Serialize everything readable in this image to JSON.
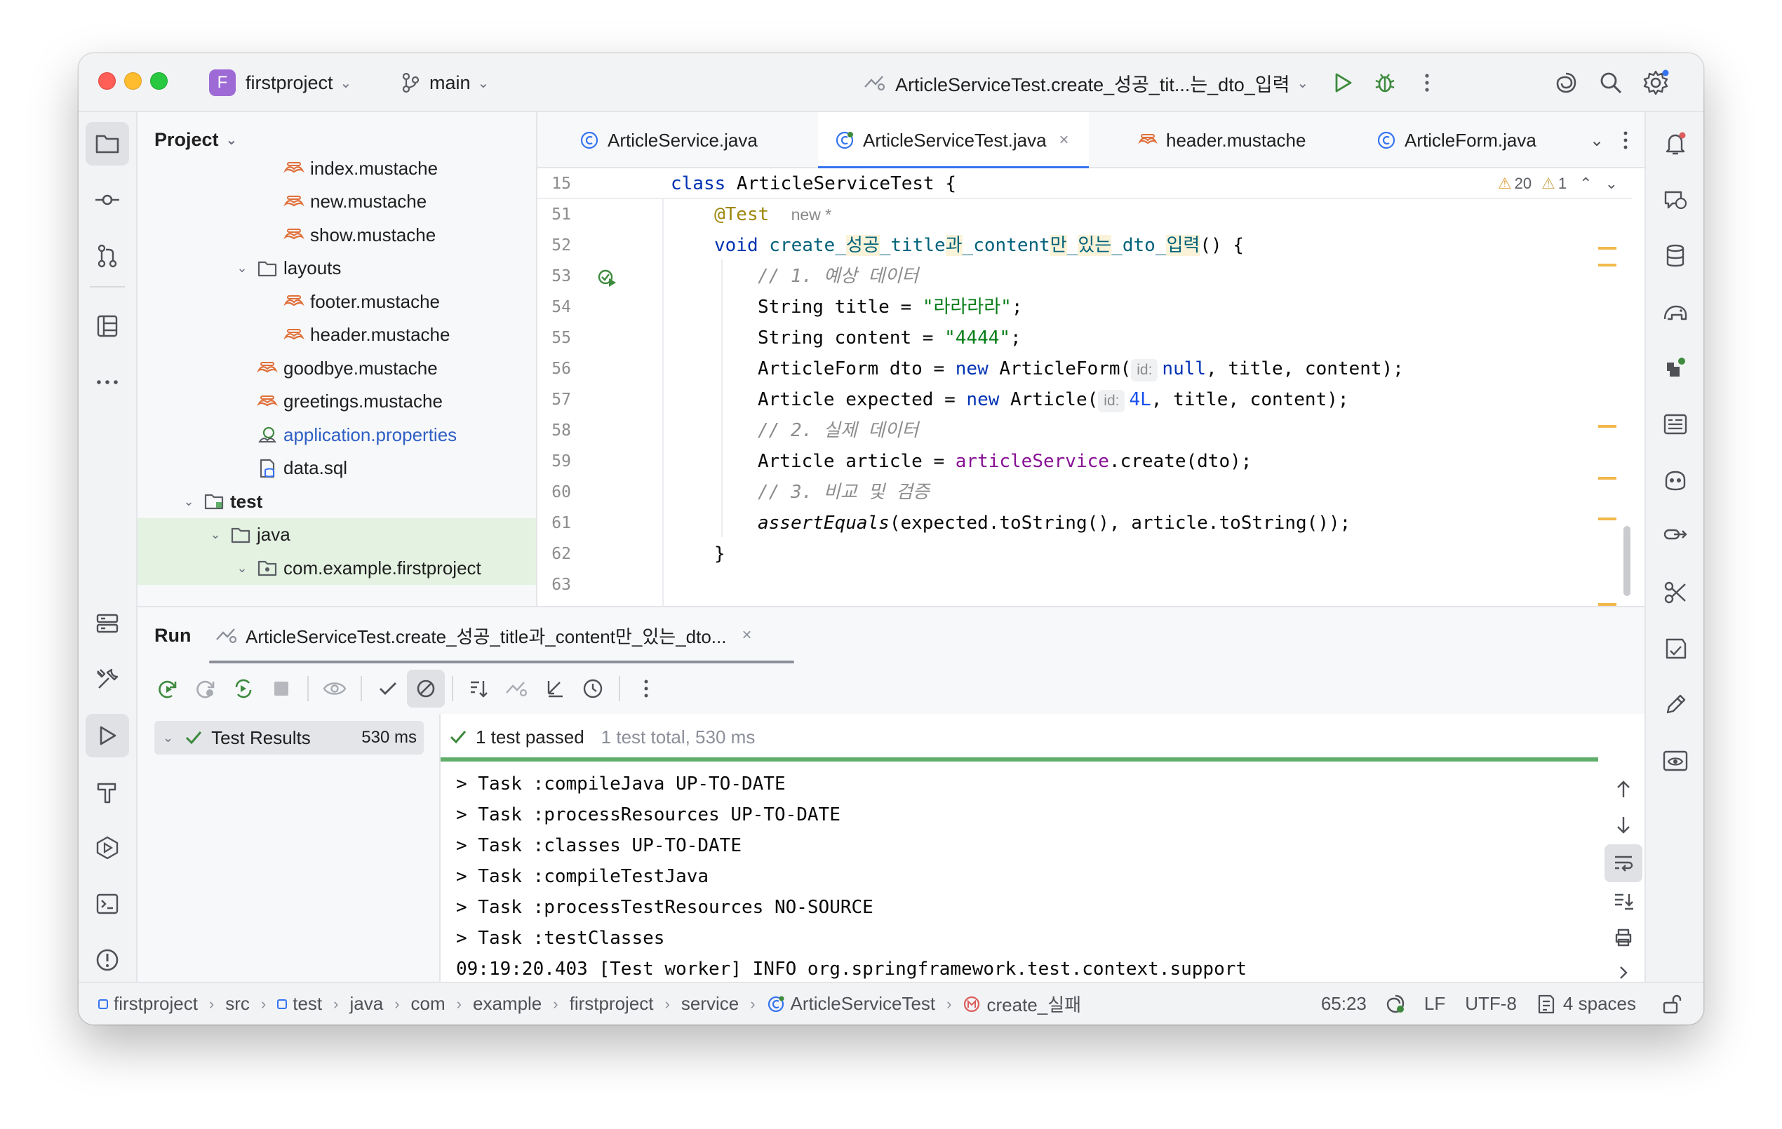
{
  "titlebar": {
    "project_badge": "F",
    "project_name": "firstproject",
    "branch": "main",
    "run_config": "ArticleServiceTest.create_성공_tit...는_dto_입력"
  },
  "project_panel": {
    "title": "Project",
    "items": [
      {
        "label": "index.mustache",
        "type": "mustache",
        "indent": 4
      },
      {
        "label": "new.mustache",
        "type": "mustache",
        "indent": 4
      },
      {
        "label": "show.mustache",
        "type": "mustache",
        "indent": 4
      },
      {
        "label": "layouts",
        "type": "folder",
        "indent": 3,
        "expanded": true
      },
      {
        "label": "footer.mustache",
        "type": "mustache",
        "indent": 4
      },
      {
        "label": "header.mustache",
        "type": "mustache",
        "indent": 4
      },
      {
        "label": "goodbye.mustache",
        "type": "mustache",
        "indent": 3
      },
      {
        "label": "greetings.mustache",
        "type": "mustache",
        "indent": 3
      },
      {
        "label": "application.properties",
        "type": "properties",
        "indent": 3
      },
      {
        "label": "data.sql",
        "type": "sql",
        "indent": 3
      },
      {
        "label": "test",
        "type": "test-folder",
        "indent": 1,
        "expanded": true
      },
      {
        "label": "java",
        "type": "folder",
        "indent": 2,
        "expanded": true
      },
      {
        "label": "com.example.firstproject",
        "type": "package",
        "indent": 3,
        "expanded": true
      }
    ]
  },
  "editor": {
    "tabs": [
      {
        "label": "ArticleService.java",
        "active": false
      },
      {
        "label": "ArticleServiceTest.java",
        "active": true
      },
      {
        "label": "header.mustache",
        "active": false
      },
      {
        "label": "ArticleForm.java",
        "active": false
      }
    ],
    "sticky_line_number": "15",
    "sticky_code": "class ArticleServiceTest {",
    "warnings_count": "20",
    "weak_warnings_count": "1",
    "line_numbers": [
      "51",
      "52",
      "53",
      "54",
      "55",
      "56",
      "57",
      "58",
      "59",
      "60",
      "61",
      "62",
      "63"
    ],
    "lines": {
      "l52_annotation": "@Test",
      "l52_author": "new *",
      "l53_void": "void ",
      "l53_name_a": "create_",
      "l53_name_b": "성공",
      "l53_name_c": "_title",
      "l53_name_d": "과",
      "l53_name_e": "_content",
      "l53_name_f": "만",
      "l53_name_g": "_",
      "l53_name_h": "있는",
      "l53_name_i": "_dto_",
      "l53_name_j": "입력",
      "l53_tail": "() {",
      "l54": "// 1. 예상 데이터",
      "l55_a": "String title = ",
      "l55_b": "\"라라라라\"",
      "l55_c": ";",
      "l56_a": "String content = ",
      "l56_b": "\"4444\"",
      "l56_c": ";",
      "l57_a": "ArticleForm dto = ",
      "l57_new": "new",
      "l57_b": " ArticleForm(",
      "l57_hint": "id:",
      "l57_null": "null",
      "l57_c": ", title, content);",
      "l58_a": "Article expected = ",
      "l58_new": "new",
      "l58_b": " Article(",
      "l58_hint": "id:",
      "l58_num": "4L",
      "l58_c": ", title, content);",
      "l59": "// 2. 실제 데이터",
      "l60_a": "Article article = ",
      "l60_field": "articleService",
      "l60_b": ".create(dto);",
      "l61": "// 3. 비교 및 검증",
      "l62_a": "assertEquals",
      "l62_b": "(expected.toString(), article.toString());",
      "l63": "}"
    }
  },
  "run_panel": {
    "title": "Run",
    "tab_label": "ArticleServiceTest.create_성공_title과_content만_있는_dto...",
    "results_label": "Test Results",
    "results_time": "530 ms",
    "status": "1 test passed",
    "summary": "1 test total, 530 ms",
    "console_lines": [
      "> Task :compileJava UP-TO-DATE",
      "> Task :processResources UP-TO-DATE",
      "> Task :classes UP-TO-DATE",
      "> Task :compileTestJava",
      "> Task :processTestResources NO-SOURCE",
      "> Task :testClasses",
      "09:19:20.403 [Test worker] INFO org.springframework.test.context.support"
    ]
  },
  "statusbar": {
    "breadcrumbs": [
      "firstproject",
      "src",
      "test",
      "java",
      "com",
      "example",
      "firstproject",
      "service",
      "ArticleServiceTest",
      "create_실패"
    ],
    "position": "65:23",
    "line_ending": "LF",
    "encoding": "UTF-8",
    "indent": "4 spaces"
  },
  "colors": {
    "accent": "#3574f0",
    "pass": "#3e8a3e",
    "mustache": "#e0703a",
    "class_icon": "#3574f0"
  }
}
